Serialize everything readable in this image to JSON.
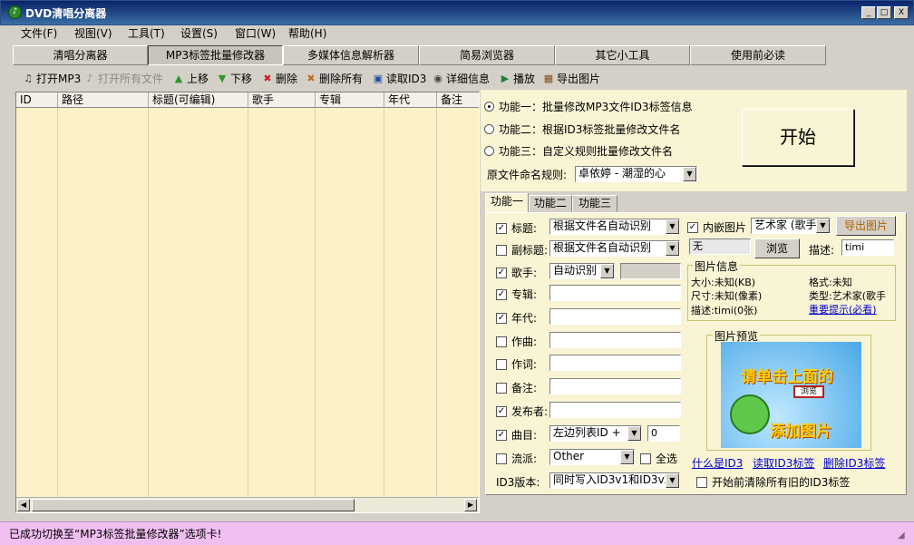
{
  "window": {
    "title": "DVD清唱分离器",
    "icon": "app-icon",
    "min": "_",
    "max": "□",
    "close": "X"
  },
  "menu": [
    "文件(F)",
    "视图(V)",
    "工具(T)",
    "设置(S)",
    "窗口(W)",
    "帮助(H)"
  ],
  "tabs": [
    "清唱分离器",
    "MP3标签批量修改器",
    "多媒体信息解析器",
    "简易浏览器",
    "其它小工具",
    "使用前必读"
  ],
  "toolbar": [
    {
      "label": "打开MP3",
      "icon": "open-mp3-icon",
      "glyph": "♫",
      "enabled": true
    },
    {
      "label": "打开所有文件",
      "icon": "open-all-files-icon",
      "glyph": "♪",
      "enabled": false
    },
    {
      "label": "上移",
      "icon": "arrow-up-icon",
      "glyph": "▲",
      "enabled": true
    },
    {
      "label": "下移",
      "icon": "arrow-down-icon",
      "glyph": "▼",
      "enabled": true
    },
    {
      "label": "删除",
      "icon": "delete-icon",
      "glyph": "✖",
      "enabled": true
    },
    {
      "label": "删除所有",
      "icon": "delete-all-icon",
      "glyph": "✖",
      "enabled": true
    },
    {
      "label": "读取ID3",
      "icon": "read-id3-icon",
      "glyph": "▣",
      "enabled": true
    },
    {
      "label": "详细信息",
      "icon": "details-icon",
      "glyph": "◉",
      "enabled": true
    },
    {
      "label": "播放",
      "icon": "play-icon",
      "glyph": "▶",
      "enabled": true
    },
    {
      "label": "导出图片",
      "icon": "export-image-icon",
      "glyph": "▦",
      "enabled": true
    }
  ],
  "grid": {
    "columns": [
      "ID",
      "路径",
      "标题(可编辑)",
      "歌手",
      "专辑",
      "年代",
      "备注"
    ]
  },
  "functions": {
    "f1": "功能一：批量修改MP3文件ID3标签信息",
    "f2": "功能二：根据ID3标签批量修改文件名",
    "f3": "功能三：自定义规则批量修改文件名",
    "selected": "f1",
    "rule_label": "原文件命名规则:",
    "rule_value": "卓依婷 - 潮湿的心",
    "start": "开始"
  },
  "subtabs": [
    "功能一",
    "功能二",
    "功能三"
  ],
  "fields": {
    "title": {
      "label": "标题:",
      "checked": true,
      "value": "根据文件名自动识别"
    },
    "subtitle": {
      "label": "副标题:",
      "checked": false,
      "value": "根据文件名自动识别"
    },
    "artist": {
      "label": "歌手:",
      "checked": true,
      "value": "自动识别"
    },
    "album": {
      "label": "专辑:",
      "checked": true
    },
    "year": {
      "label": "年代:",
      "checked": true
    },
    "composer": {
      "label": "作曲:",
      "checked": false
    },
    "lyricist": {
      "label": "作词:",
      "checked": false
    },
    "comment": {
      "label": "备注:",
      "checked": false
    },
    "publisher": {
      "label": "发布者:",
      "checked": true
    },
    "track": {
      "label": "曲目:",
      "checked": true,
      "value": "左边列表ID +",
      "number": "0"
    },
    "genre": {
      "label": "流派:",
      "checked": false,
      "value": "Other",
      "selectall": "全选"
    },
    "id3ver": {
      "label": "ID3版本:",
      "value": "同时写入ID3v1和ID3v2"
    }
  },
  "image": {
    "embed_label": "内嵌图片",
    "embed_checked": true,
    "type_value": "艺术家 (歌手",
    "export_btn": "导出图片",
    "path_value": "无",
    "browse_btn": "浏览",
    "desc_label": "描述:",
    "desc_value": "timi",
    "info_title": "图片信息",
    "size": "大小:未知(KB)",
    "format": "格式:未知",
    "dims": "尺寸:未知(像素)",
    "type": "类型:艺术家(歌手",
    "desc": "描述:timi(0张)",
    "important": "重要提示(必看)",
    "preview_title": "图片预览",
    "preview_line1": "请单击上面的",
    "preview_btn": "浏览",
    "preview_line2": "添加图片"
  },
  "links": {
    "what": "什么是ID3",
    "read": "读取ID3标签",
    "remove": "删除ID3标签"
  },
  "clear_old": "开始前清除所有旧的ID3标签",
  "status": "已成功切换至“MP3标签批量修改器”选项卡!"
}
